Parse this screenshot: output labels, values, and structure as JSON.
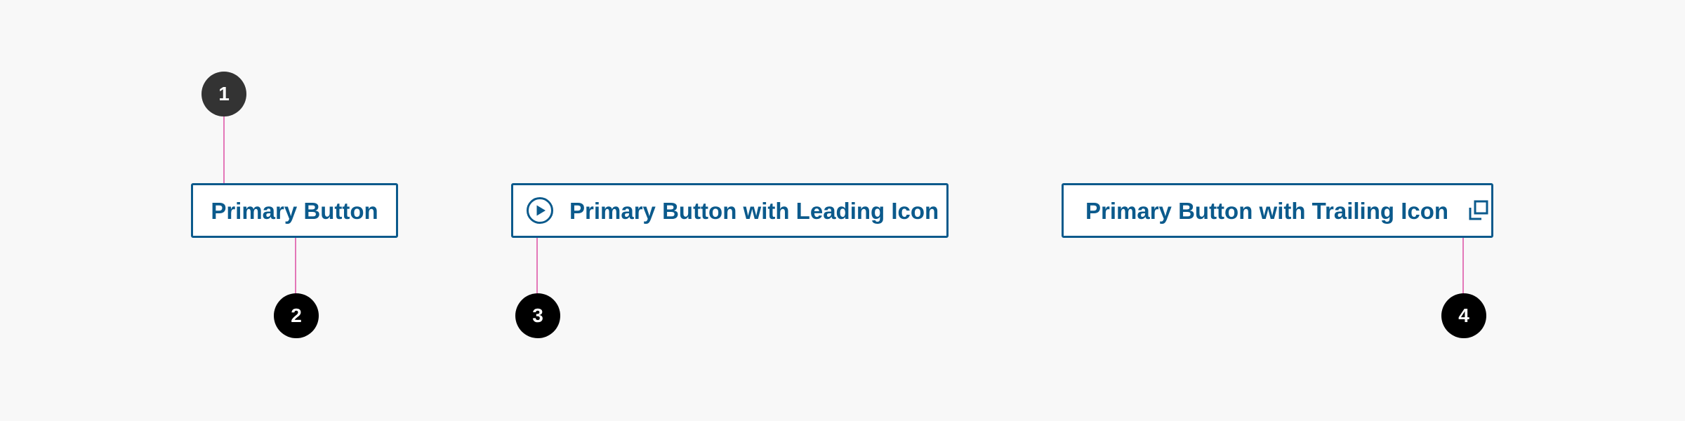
{
  "buttons": {
    "primary": {
      "label": "Primary Button"
    },
    "leading_icon": {
      "label": "Primary Button with Leading Icon",
      "icon": "play-circle-icon"
    },
    "trailing_icon": {
      "label": "Primary Button with Trailing Icon",
      "icon": "external-link-icon"
    }
  },
  "annotations": [
    {
      "number": "1",
      "target": "container"
    },
    {
      "number": "2",
      "target": "label"
    },
    {
      "number": "3",
      "target": "leading-icon"
    },
    {
      "number": "4",
      "target": "trailing-icon"
    }
  ],
  "colors": {
    "background": "#f8f8f8",
    "button_border": "#0b5a8c",
    "button_text": "#0b5a8c",
    "leader_line": "#e377b8",
    "marker_dark": "#333333",
    "marker": "#000000"
  }
}
